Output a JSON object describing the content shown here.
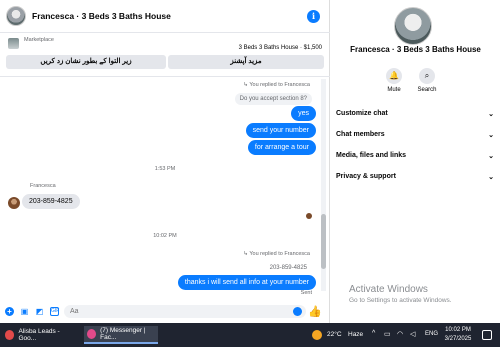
{
  "header": {
    "title": "Francesca · 3 Beds 3 Baths House",
    "info_icon": "i"
  },
  "marketplace": {
    "label": "Marketplace",
    "listing": "3 Beds 3 Baths House · $1,500",
    "button_1": "زیر التوا کے بطور نشان زد کریں",
    "button_2": "مزید آپشنز"
  },
  "messages": {
    "reply_1_header": "↳ You replied to Francesca",
    "reply_1_quote": "Do you accept section 8?",
    "out_1": "yes",
    "out_2": "send your number",
    "out_3": "for arrange a tour",
    "time_1": "1:53 PM",
    "sender_name": "Francesca",
    "in_1": "203-859-4825",
    "time_2": "10:02 PM",
    "reply_2_header": "↳ You replied to Francesca",
    "reply_2_quote": "203-859-4825",
    "out_4": "thanks i will send all info at your number",
    "sent_label": "Sent"
  },
  "composer": {
    "placeholder": "Aa"
  },
  "panel": {
    "name": "Francesca · 3 Beds 3 Baths House",
    "mute_label": "Mute",
    "search_label": "Search",
    "rows": [
      "Customize chat",
      "Chat members",
      "Media, files and links",
      "Privacy & support"
    ]
  },
  "watermark": {
    "title": "Activate Windows",
    "subtitle": "Go to Settings to activate Windows."
  },
  "taskbar": {
    "task_1": "Alisba Leads - Goo...",
    "task_2": "(7) Messenger | Fac...",
    "temperature": "22°C",
    "weather": "Haze",
    "language": "ENG",
    "time": "10:02 PM",
    "date": "3/27/2025"
  },
  "colors": {
    "accent": "#0a7cff",
    "taskbar": "#1f2430"
  }
}
